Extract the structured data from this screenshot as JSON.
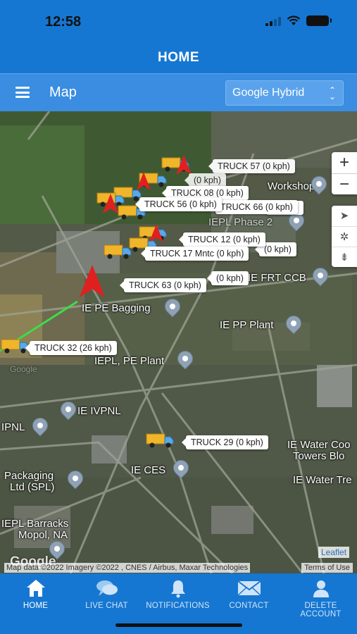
{
  "status_bar": {
    "time": "12:58"
  },
  "header": {
    "title": "HOME"
  },
  "toolbar": {
    "title": "Map",
    "map_type": "Google Hybrid"
  },
  "map": {
    "places": [
      "IE PE Bagging",
      "IE PP Plant",
      "IEPL, PE Plant",
      "IE IVPNL",
      "IPNL",
      "IE CES",
      "Packaging",
      "Ltd (SPL)",
      "IEPL Barracks",
      "Mopol, NA",
      "IE Water Coo",
      "Towers Blo",
      "IE Water Tre",
      "IE FRT CCB",
      "Workshop",
      "IEPL Phase 2",
      "Google"
    ],
    "trucks": [
      "TRUCK 57 (0 kph)",
      "TRUCK 08 (0 kph)",
      "TRUCK 56 (0 kph)",
      "TRUCK 66 (0 kph)",
      "TRUCK 12 (0 kph)",
      "TRUCK 17 Mntc (0 kph)",
      "TRUCK 63 (0 kph)",
      "TRUCK 32 (26 kph)",
      "TRUCK 29 (0 kph)",
      "(0 kph)",
      "(0 kph)",
      "(0 kph)",
      "(0 kph)",
      "(0 kph)"
    ],
    "zoom_in": "+",
    "zoom_out": "−",
    "leaflet": "Leaflet",
    "attribution": "Map data ©2022 Imagery ©2022 , CNES / Airbus, Maxar Technologies",
    "terms": "Terms of Use",
    "google_logo": "Google"
  },
  "tabs": [
    {
      "label": "HOME",
      "icon": "home-icon",
      "active": true
    },
    {
      "label": "LIVE CHAT",
      "icon": "chat-icon",
      "active": false
    },
    {
      "label": "NOTIFICATIONS",
      "icon": "bell-icon",
      "active": false
    },
    {
      "label": "CONTACT",
      "icon": "envelope-icon",
      "active": false
    },
    {
      "label": "DELETE ACCOUNT",
      "icon": "user-icon",
      "active": false
    }
  ],
  "colors": {
    "primary": "#1677d2",
    "toolbar": "#3a8de0",
    "route": "#3ddc4a",
    "marker": "#e02020"
  }
}
